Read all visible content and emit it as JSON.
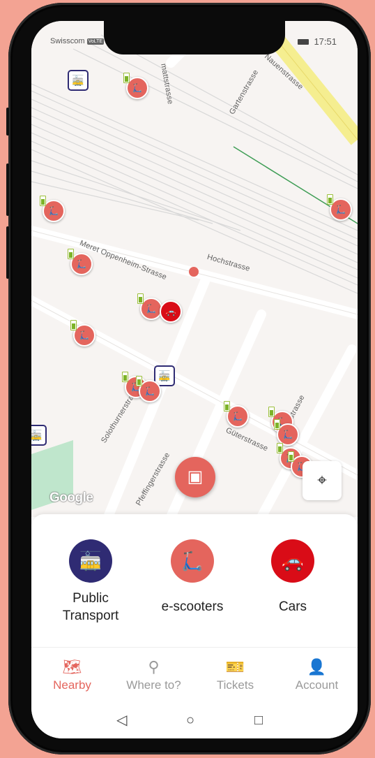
{
  "status": {
    "carrier": "Swisscom",
    "carrier_badge": "VoLTE",
    "time": "17:51"
  },
  "map": {
    "streets": [
      "mattstrasse",
      "Gartenstrasse",
      "Nauenstrasse",
      "Meret Oppenheim-Strasse",
      "Hochstrasse",
      "Solothurnerstrasse",
      "Pfeffingerstrasse",
      "Güterstrasse",
      "erstrasse"
    ],
    "attribution": "Google"
  },
  "categories": [
    {
      "label": "Public Transport",
      "color": "#2f2b73",
      "icon": "tram-icon"
    },
    {
      "label": "e-scooters",
      "color": "#e4655d",
      "icon": "scooter-icon"
    },
    {
      "label": "Cars",
      "color": "#d90c17",
      "icon": "car-icon"
    }
  ],
  "tabs": [
    {
      "label": "Nearby",
      "icon": "map-icon",
      "active": true
    },
    {
      "label": "Where to?",
      "icon": "search-icon",
      "active": false
    },
    {
      "label": "Tickets",
      "icon": "ticket-icon",
      "active": false
    },
    {
      "label": "Account",
      "icon": "person-icon",
      "active": false
    }
  ],
  "colors": {
    "accent": "#e4655d",
    "car": "#d90c17",
    "transport": "#2f2b73",
    "background": "#f3a393"
  }
}
